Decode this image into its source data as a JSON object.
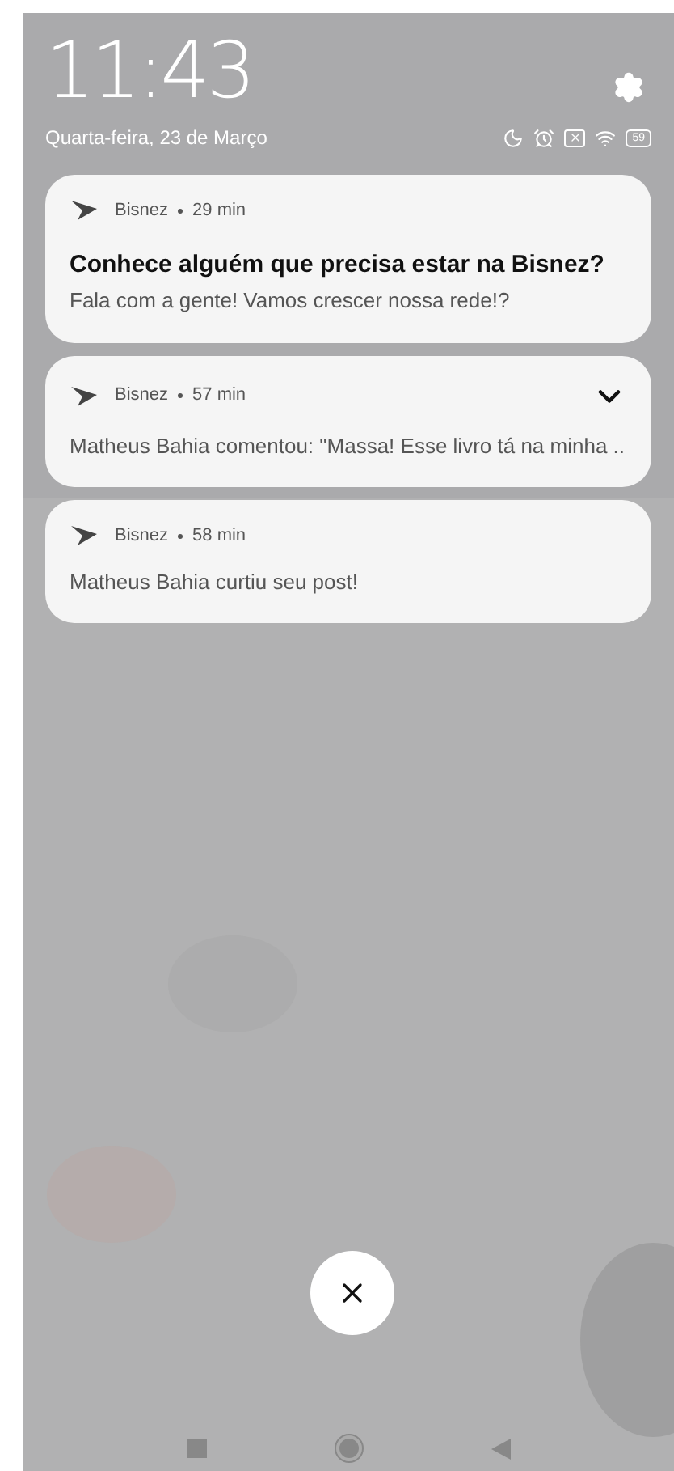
{
  "status": {
    "time": "11:43",
    "date": "Quarta-feira, 23 de Março",
    "battery": "59"
  },
  "notifications": [
    {
      "app": "Bisnez",
      "time": "29 min",
      "title": "Conhece alguém que precisa estar na Bisnez?",
      "text": "Fala com a gente! Vamos crescer nossa rede!?",
      "expandable": false
    },
    {
      "app": "Bisnez",
      "time": "57 min",
      "text": "Matheus Bahia comentou: \"Massa! Esse livro tá na minha ..",
      "expandable": true
    },
    {
      "app": "Bisnez",
      "time": "58 min",
      "text": "Matheus Bahia curtiu seu post!",
      "expandable": false
    }
  ]
}
